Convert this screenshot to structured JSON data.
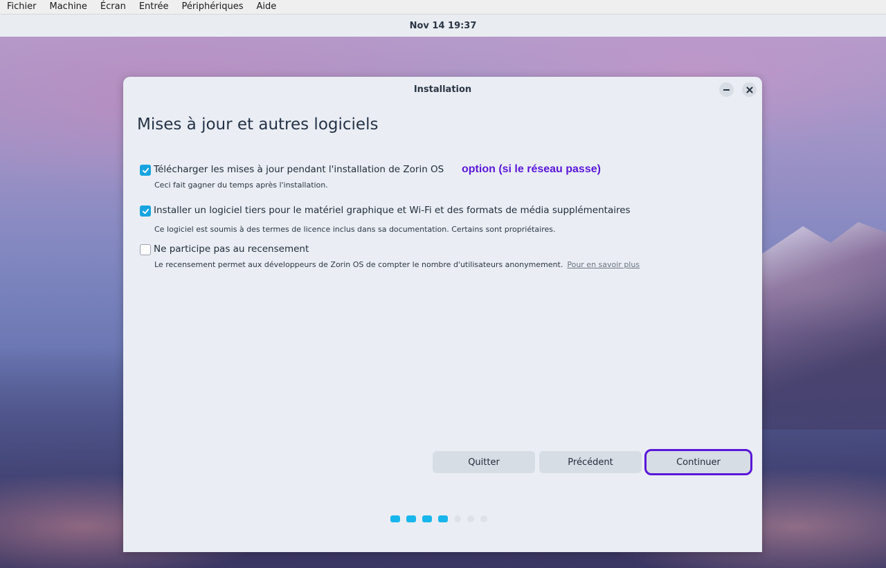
{
  "menubar": {
    "items": [
      "Fichier",
      "Machine",
      "Écran",
      "Entrée",
      "Périphériques",
      "Aide"
    ]
  },
  "topbar": {
    "clock": "Nov 14  19:37"
  },
  "window": {
    "title": "Installation",
    "heading": "Mises à jour et autres logiciels",
    "options": [
      {
        "label": "Télécharger les mises à jour pendant l'installation de Zorin OS",
        "description": "Ceci fait gagner du temps après l'installation.",
        "checked": true
      },
      {
        "label": "Installer un logiciel tiers pour le matériel graphique et Wi-Fi et des formats de média supplémentaires",
        "description": "Ce logiciel est soumis à des termes de licence inclus dans sa documentation. Certains sont propriétaires.",
        "checked": true
      },
      {
        "label": "Ne participe pas au recensement",
        "description": "Le recensement permet aux développeurs de Zorin OS de compter le nombre d'utilisateurs anonymement.",
        "link": "Pour en savoir plus",
        "checked": false
      }
    ],
    "annotation": "option (si le réseau passe)",
    "buttons": {
      "quit": "Quitter",
      "previous": "Précédent",
      "continue": "Continuer"
    },
    "progress": {
      "total_steps": 7,
      "completed_steps": 4
    }
  },
  "colors": {
    "accent": "#18a4e0",
    "highlight": "#5a16d8",
    "window_bg": "#eaeef4",
    "button_bg": "#d7dde5"
  }
}
